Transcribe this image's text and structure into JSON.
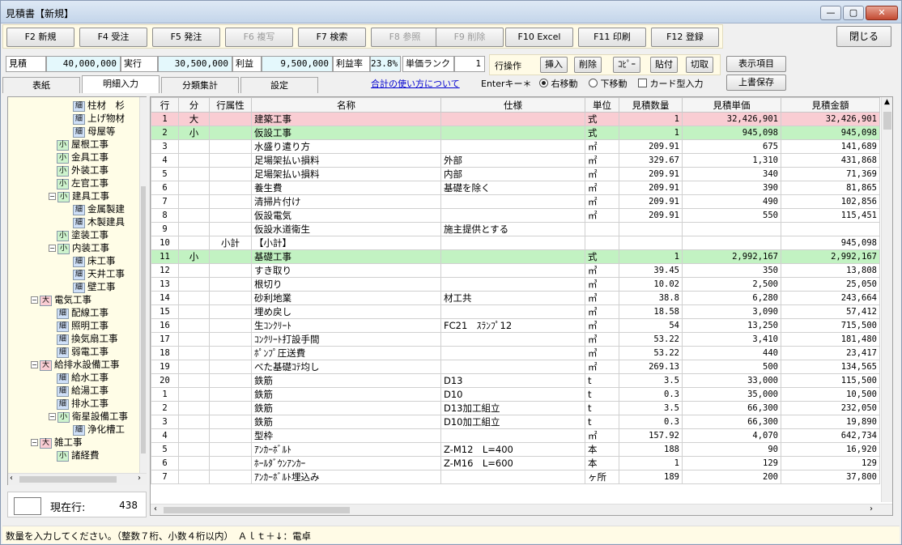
{
  "window": {
    "title": "見積書【新規】"
  },
  "fkeys": [
    {
      "label": "F2 新規",
      "enabled": true
    },
    {
      "label": "F4 受注",
      "enabled": true
    },
    {
      "label": "F5 発注",
      "enabled": true
    },
    {
      "label": "F6 複写",
      "enabled": false
    },
    {
      "label": "F7 検索",
      "enabled": true
    },
    {
      "label": "F8 参照",
      "enabled": false
    },
    {
      "label": "F9 削除",
      "enabled": false
    },
    {
      "label": "F10 Excel",
      "enabled": true
    },
    {
      "label": "F11 印刷",
      "enabled": true
    },
    {
      "label": "F12 登録",
      "enabled": true
    }
  ],
  "close_label": "閉じる",
  "summary": {
    "estimate_label": "見積",
    "estimate_value": "40,000,000",
    "actual_label": "実行",
    "actual_value": "30,500,000",
    "profit_label": "利益",
    "profit_value": "9,500,000",
    "rate_label": "利益率",
    "rate_value": "23.8%",
    "rank_label": "単価ランク",
    "rank_value": "1"
  },
  "ops": {
    "label": "行操作",
    "insert": "挿入",
    "delete": "削除",
    "copy": "ｺﾋﾟｰ",
    "paste": "貼付",
    "cut": "切取"
  },
  "display_items": "表示項目",
  "overwrite_save": "上書保存",
  "tabs": [
    "表紙",
    "明細入力",
    "分類集計",
    "設定"
  ],
  "active_tab": 1,
  "help_link": "合計の使い方について",
  "enter_key": {
    "label": "Enterキー＊",
    "right": "右移動",
    "down": "下移動",
    "card": "カード型入力"
  },
  "tree": [
    {
      "level": 3,
      "type": "細",
      "label": "柱材　杉"
    },
    {
      "level": 3,
      "type": "細",
      "label": "上げ物材"
    },
    {
      "level": 3,
      "type": "細",
      "label": "母屋等"
    },
    {
      "level": 2,
      "type": "小",
      "label": "屋根工事"
    },
    {
      "level": 2,
      "type": "小",
      "label": "金具工事"
    },
    {
      "level": 2,
      "type": "小",
      "label": "外装工事"
    },
    {
      "level": 2,
      "type": "小",
      "label": "左官工事"
    },
    {
      "level": 2,
      "type": "小",
      "label": "建具工事",
      "expand": "−"
    },
    {
      "level": 3,
      "type": "細",
      "label": "金属製建"
    },
    {
      "level": 3,
      "type": "細",
      "label": "木製建具"
    },
    {
      "level": 2,
      "type": "小",
      "label": "塗装工事"
    },
    {
      "level": 2,
      "type": "小",
      "label": "内装工事",
      "expand": "−"
    },
    {
      "level": 3,
      "type": "細",
      "label": "床工事"
    },
    {
      "level": 3,
      "type": "細",
      "label": "天井工事"
    },
    {
      "level": 3,
      "type": "細",
      "label": "壁工事"
    },
    {
      "level": 1,
      "type": "大",
      "label": "電気工事",
      "expand": "−"
    },
    {
      "level": 2,
      "type": "細",
      "label": "配線工事"
    },
    {
      "level": 2,
      "type": "細",
      "label": "照明工事"
    },
    {
      "level": 2,
      "type": "細",
      "label": "換気扇工事"
    },
    {
      "level": 2,
      "type": "細",
      "label": "弱電工事"
    },
    {
      "level": 1,
      "type": "大",
      "label": "給排水設備工事",
      "expand": "−"
    },
    {
      "level": 2,
      "type": "細",
      "label": "給水工事"
    },
    {
      "level": 2,
      "type": "細",
      "label": "給湯工事"
    },
    {
      "level": 2,
      "type": "細",
      "label": "排水工事"
    },
    {
      "level": 2,
      "type": "小",
      "label": "衛星設備工事",
      "expand": "−"
    },
    {
      "level": 3,
      "type": "細",
      "label": "浄化槽工"
    },
    {
      "level": 1,
      "type": "大",
      "label": "雑工事",
      "expand": "−"
    },
    {
      "level": 2,
      "type": "小",
      "label": "諸経費"
    }
  ],
  "current_row": {
    "label": "現在行:",
    "value": "438"
  },
  "grid": {
    "headers": [
      "行",
      "分",
      "行属性",
      "名称",
      "仕様",
      "単位",
      "見積数量",
      "見積単価",
      "見積金額"
    ],
    "rows": [
      {
        "no": "1",
        "kind": "大",
        "attr": "",
        "name": "建築工事",
        "spec": "",
        "unit": "式",
        "qty": "1",
        "price": "32,426,901",
        "amount": "32,426,901",
        "style": "dai"
      },
      {
        "no": "2",
        "kind": "小",
        "attr": "",
        "name": "仮設工事",
        "spec": "",
        "unit": "式",
        "qty": "1",
        "price": "945,098",
        "amount": "945,098",
        "style": "sho"
      },
      {
        "no": "3",
        "kind": "",
        "attr": "",
        "name": "水盛り遣り方",
        "spec": "",
        "unit": "㎡",
        "qty": "209.91",
        "price": "675",
        "amount": "141,689",
        "style": ""
      },
      {
        "no": "4",
        "kind": "",
        "attr": "",
        "name": "足場架払い損料",
        "spec": "外部",
        "unit": "㎡",
        "qty": "329.67",
        "price": "1,310",
        "amount": "431,868",
        "style": ""
      },
      {
        "no": "5",
        "kind": "",
        "attr": "",
        "name": "足場架払い損料",
        "spec": "内部",
        "unit": "㎡",
        "qty": "209.91",
        "price": "340",
        "amount": "71,369",
        "style": ""
      },
      {
        "no": "6",
        "kind": "",
        "attr": "",
        "name": "養生費",
        "spec": "基礎を除く",
        "unit": "㎡",
        "qty": "209.91",
        "price": "390",
        "amount": "81,865",
        "style": ""
      },
      {
        "no": "7",
        "kind": "",
        "attr": "",
        "name": "清掃片付け",
        "spec": "",
        "unit": "㎡",
        "qty": "209.91",
        "price": "490",
        "amount": "102,856",
        "style": ""
      },
      {
        "no": "8",
        "kind": "",
        "attr": "",
        "name": "仮設電気",
        "spec": "",
        "unit": "㎡",
        "qty": "209.91",
        "price": "550",
        "amount": "115,451",
        "style": ""
      },
      {
        "no": "9",
        "kind": "",
        "attr": "",
        "name": "仮設水道衛生",
        "spec": "施主提供とする",
        "unit": "",
        "qty": "",
        "price": "",
        "amount": "",
        "style": ""
      },
      {
        "no": "10",
        "kind": "",
        "attr": "小計",
        "name": "【小計】",
        "spec": "",
        "unit": "",
        "qty": "",
        "price": "",
        "amount": "945,098",
        "style": ""
      },
      {
        "no": "11",
        "kind": "小",
        "attr": "",
        "name": "基礎工事",
        "spec": "",
        "unit": "式",
        "qty": "1",
        "price": "2,992,167",
        "amount": "2,992,167",
        "style": "sho"
      },
      {
        "no": "12",
        "kind": "",
        "attr": "",
        "name": "すき取り",
        "spec": "",
        "unit": "㎥",
        "qty": "39.45",
        "price": "350",
        "amount": "13,808",
        "style": ""
      },
      {
        "no": "13",
        "kind": "",
        "attr": "",
        "name": "根切り",
        "spec": "",
        "unit": "㎥",
        "qty": "10.02",
        "price": "2,500",
        "amount": "25,050",
        "style": ""
      },
      {
        "no": "14",
        "kind": "",
        "attr": "",
        "name": "砂利地業",
        "spec": "材工共",
        "unit": "㎥",
        "qty": "38.8",
        "price": "6,280",
        "amount": "243,664",
        "style": ""
      },
      {
        "no": "15",
        "kind": "",
        "attr": "",
        "name": "埋め戻し",
        "spec": "",
        "unit": "㎥",
        "qty": "18.58",
        "price": "3,090",
        "amount": "57,412",
        "style": ""
      },
      {
        "no": "16",
        "kind": "",
        "attr": "",
        "name": "生ｺﾝｸﾘｰﾄ",
        "spec": "FC21　ｽﾗﾝﾌﾟ12",
        "unit": "㎥",
        "qty": "54",
        "price": "13,250",
        "amount": "715,500",
        "style": ""
      },
      {
        "no": "17",
        "kind": "",
        "attr": "",
        "name": "ｺﾝｸﾘｰﾄ打設手間",
        "spec": "",
        "unit": "㎥",
        "qty": "53.22",
        "price": "3,410",
        "amount": "181,480",
        "style": ""
      },
      {
        "no": "18",
        "kind": "",
        "attr": "",
        "name": "ﾎﾟﾝﾌﾟ圧送費",
        "spec": "",
        "unit": "㎥",
        "qty": "53.22",
        "price": "440",
        "amount": "23,417",
        "style": ""
      },
      {
        "no": "19",
        "kind": "",
        "attr": "",
        "name": "べた基礎ｺﾃ均し",
        "spec": "",
        "unit": "㎡",
        "qty": "269.13",
        "price": "500",
        "amount": "134,565",
        "style": ""
      },
      {
        "no": "20",
        "kind": "",
        "attr": "",
        "name": "鉄筋",
        "spec": "D13",
        "unit": "t",
        "qty": "3.5",
        "price": "33,000",
        "amount": "115,500",
        "style": ""
      },
      {
        "no": "1",
        "kind": "",
        "attr": "",
        "name": "鉄筋",
        "spec": "D10",
        "unit": "t",
        "qty": "0.3",
        "price": "35,000",
        "amount": "10,500",
        "style": ""
      },
      {
        "no": "2",
        "kind": "",
        "attr": "",
        "name": "鉄筋",
        "spec": "D13加工組立",
        "unit": "t",
        "qty": "3.5",
        "price": "66,300",
        "amount": "232,050",
        "style": ""
      },
      {
        "no": "3",
        "kind": "",
        "attr": "",
        "name": "鉄筋",
        "spec": "D10加工組立",
        "unit": "t",
        "qty": "0.3",
        "price": "66,300",
        "amount": "19,890",
        "style": ""
      },
      {
        "no": "4",
        "kind": "",
        "attr": "",
        "name": "型枠",
        "spec": "",
        "unit": "㎡",
        "qty": "157.92",
        "price": "4,070",
        "amount": "642,734",
        "style": ""
      },
      {
        "no": "5",
        "kind": "",
        "attr": "",
        "name": "ｱﾝｶｰﾎﾞﾙﾄ",
        "spec": "Z-M12　L=400",
        "unit": "本",
        "qty": "188",
        "price": "90",
        "amount": "16,920",
        "style": ""
      },
      {
        "no": "6",
        "kind": "",
        "attr": "",
        "name": "ﾎｰﾙﾀﾞｳﾝｱﾝｶｰ",
        "spec": "Z-M16　L=600",
        "unit": "本",
        "qty": "1",
        "price": "129",
        "amount": "129",
        "style": ""
      },
      {
        "no": "7",
        "kind": "",
        "attr": "",
        "name": "ｱﾝｶｰﾎﾞﾙﾄ埋込み",
        "spec": "",
        "unit": "ヶ所",
        "qty": "189",
        "price": "200",
        "amount": "37,800",
        "style": ""
      }
    ]
  },
  "status": "数量を入力してください。（整数７桁、小数４桁以内）　Ａｌｔ＋↓：電卓"
}
